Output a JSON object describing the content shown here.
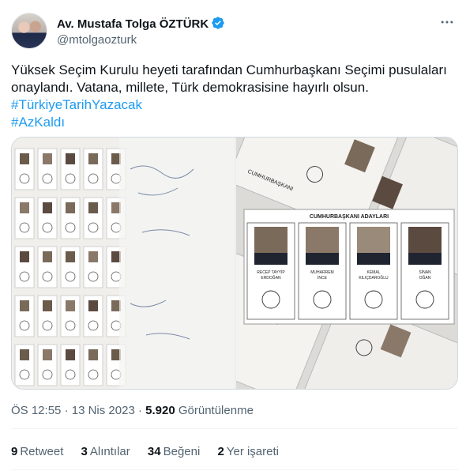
{
  "author": {
    "name": "Av. Mustafa Tolga ÖZTÜRK",
    "handle": "@mtolgaozturk",
    "verified_color": "#1d9bf0"
  },
  "more_icon": "more-horizontal-icon",
  "tweet": {
    "text": "Yüksek Seçim Kurulu heyeti tarafından Cumhurbaşkanı Seçimi pusulaları onaylandı. Vatana, millete, Türk demokrasisine hayırlı olsun.",
    "hashtags": [
      "#TürkiyeTarihYazacak",
      "#AzKaldı"
    ]
  },
  "ballot": {
    "title": "CUMHURBAŞKANI ADAYLARI",
    "side_label": "CUMHURBAŞKANI",
    "candidates": [
      {
        "line1": "RECEP TAYYİP",
        "line2": "ERDOĞAN"
      },
      {
        "line1": "MUHARREM",
        "line2": "İNCE"
      },
      {
        "line1": "KEMAL",
        "line2": "KILIÇDAROĞLU"
      },
      {
        "line1": "SİNAN",
        "line2": "OĞAN"
      }
    ]
  },
  "meta": {
    "time": "ÖS 12:55",
    "sep1": "·",
    "date": "13 Nis 2023",
    "sep2": "·",
    "views_count": "5.920",
    "views_label": "Görüntülenme"
  },
  "stats": {
    "retweets_count": "9",
    "retweets_label": "Retweet",
    "quotes_count": "3",
    "quotes_label": "Alıntılar",
    "likes_count": "34",
    "likes_label": "Beğeni",
    "bookmarks_count": "2",
    "bookmarks_label": "Yer işareti"
  },
  "colors": {
    "link": "#1d9bf0",
    "secondary_text": "#536471",
    "primary_text": "#0f1419"
  }
}
